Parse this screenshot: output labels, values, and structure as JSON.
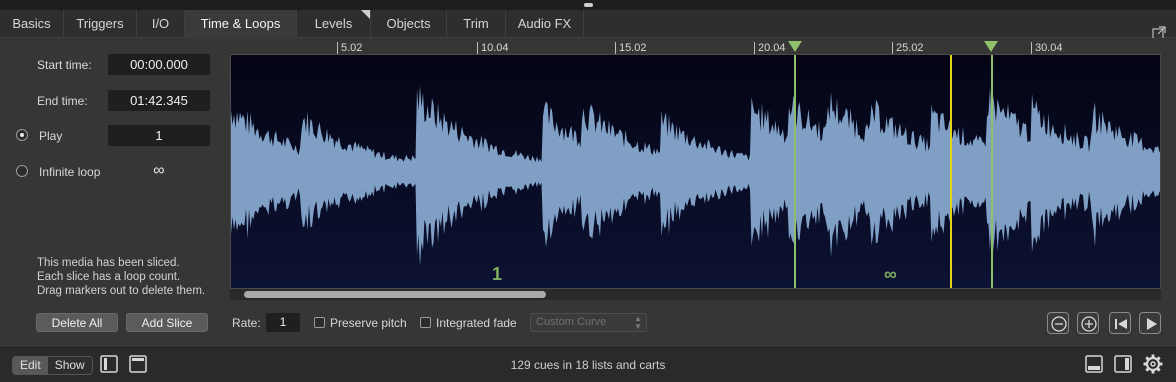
{
  "tabs": [
    {
      "label": "Basics",
      "width": 64
    },
    {
      "label": "Triggers",
      "width": 73
    },
    {
      "label": "I/O",
      "width": 48
    },
    {
      "label": "Time & Loops",
      "width": 112,
      "active": true
    },
    {
      "label": "Levels",
      "width": 74
    },
    {
      "label": "Objects",
      "width": 76
    },
    {
      "label": "Trim",
      "width": 59
    },
    {
      "label": "Audio FX",
      "width": 78
    }
  ],
  "left": {
    "start_label": "Start time:",
    "start_value": "00:00.000",
    "end_label": "End time:",
    "end_value": "01:42.345",
    "play_label": "Play",
    "play_value": "1",
    "loop_label": "Infinite loop",
    "loop_value": "∞",
    "note_lines": [
      "This media has been sliced.",
      "Each slice has a loop count.",
      "Drag markers out to delete them."
    ],
    "delete_all": "Delete All",
    "add_slice": "Add Slice"
  },
  "ruler": {
    "ticks": [
      "5.02",
      "10.04",
      "15.02",
      "20.04",
      "25.02",
      "30.04"
    ]
  },
  "waveform": {
    "color": "#7f9fc4",
    "slice_marker_color": "#8fbf6a",
    "playhead_color": "#e5d21a",
    "slice_labels": [
      "1",
      "∞"
    ]
  },
  "controls": {
    "rate_label": "Rate:",
    "rate_value": "1",
    "preserve_pitch": "Preserve pitch",
    "integrated_fade": "Integrated fade",
    "curve_placeholder": "Custom Curve"
  },
  "bottom": {
    "edit": "Edit",
    "show": "Show",
    "status": "129 cues in 18 lists and carts"
  }
}
